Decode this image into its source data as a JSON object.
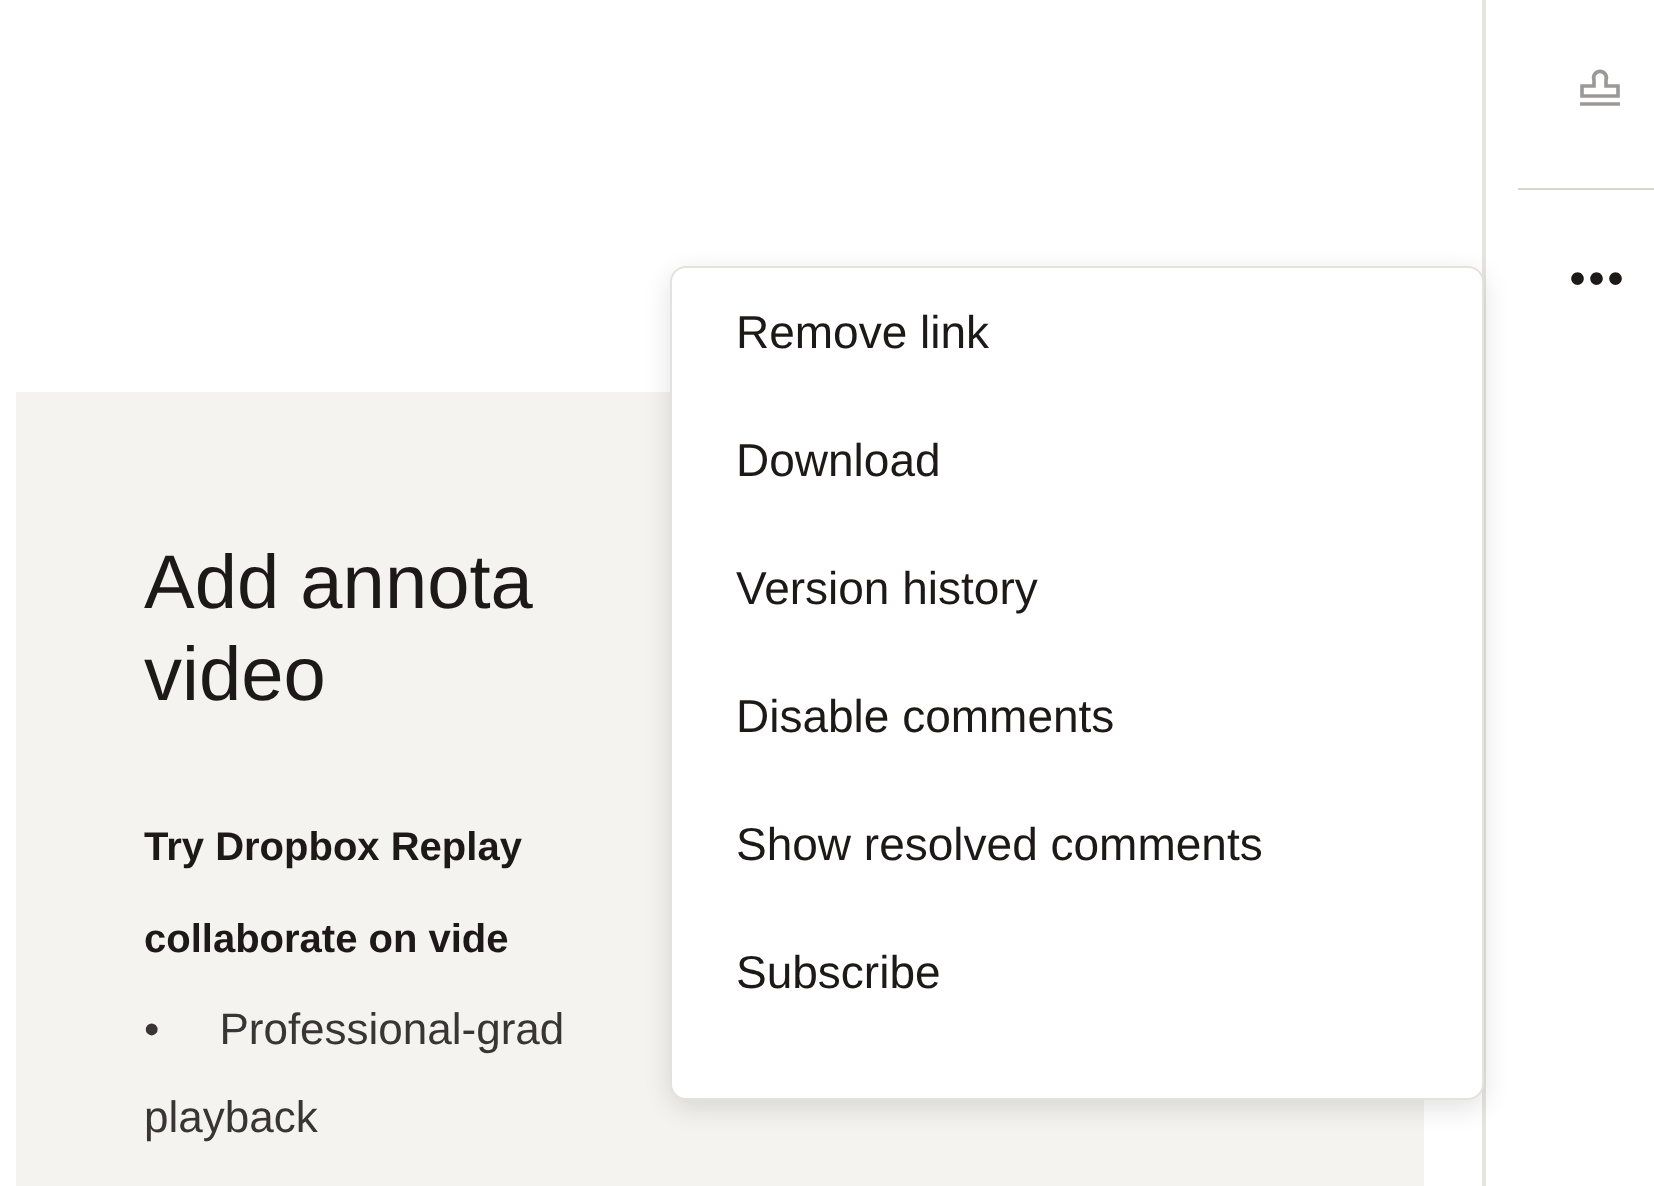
{
  "card": {
    "heading_lines": [
      "Add annota",
      "video"
    ],
    "intro_lines": [
      "Try Dropbox Replay",
      "collaborate on vide"
    ],
    "bullet": {
      "marker": "•",
      "lines": [
        "Professional-grad",
        "playback"
      ]
    }
  },
  "menu": {
    "items": [
      {
        "label": "Remove link"
      },
      {
        "label": "Download"
      },
      {
        "label": "Version history"
      },
      {
        "label": "Disable comments"
      },
      {
        "label": "Show resolved comments"
      },
      {
        "label": "Subscribe"
      }
    ]
  },
  "sidebar": {
    "more_button": "•••"
  }
}
